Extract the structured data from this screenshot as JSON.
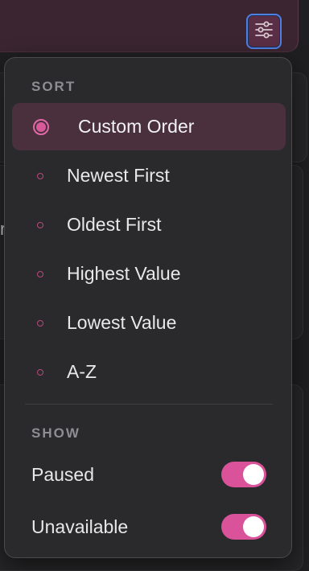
{
  "colors": {
    "accent": "#d9529a",
    "panel_bg": "#2a2a2c",
    "selected_bg": "#4a2f3d",
    "focus_ring": "#4f7fe0"
  },
  "toolbar": {
    "filter_button_icon": "sliders-icon"
  },
  "menu": {
    "sort_title": "SORT",
    "sort_options": [
      {
        "label": "Custom Order",
        "selected": true
      },
      {
        "label": "Newest First",
        "selected": false
      },
      {
        "label": "Oldest First",
        "selected": false
      },
      {
        "label": "Highest Value",
        "selected": false
      },
      {
        "label": "Lowest Value",
        "selected": false
      },
      {
        "label": "A-Z",
        "selected": false
      }
    ],
    "show_title": "SHOW",
    "show_options": [
      {
        "label": "Paused",
        "on": true
      },
      {
        "label": "Unavailable",
        "on": true
      }
    ]
  },
  "background": {
    "peek_text": "r"
  }
}
